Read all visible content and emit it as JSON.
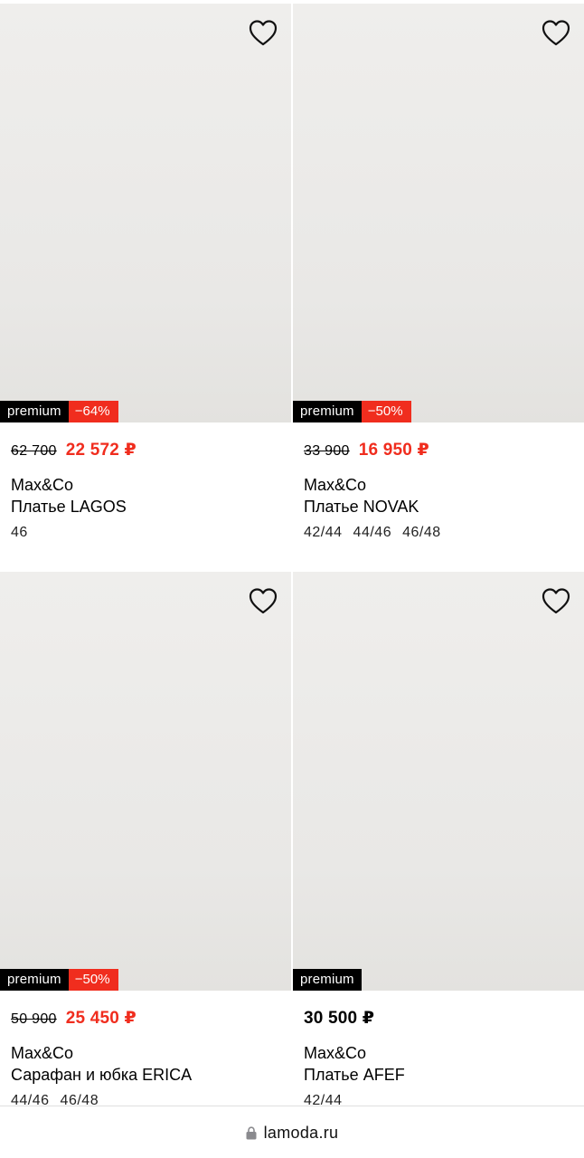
{
  "products": [
    {
      "badge_premium": "premium",
      "badge_discount": "−64%",
      "old_price": "62 700",
      "price": "22 572 ₽",
      "brand": "Max&Co",
      "name": "Платье LAGOS",
      "sizes": [
        "46"
      ],
      "dress_color": "#ebe3cf"
    },
    {
      "badge_premium": "premium",
      "badge_discount": "−50%",
      "old_price": "33 900",
      "price": "16 950 ₽",
      "brand": "Max&Co",
      "name": "Платье NOVAK",
      "sizes": [
        "42/44",
        "44/46",
        "46/48"
      ],
      "dress_color": "#161616"
    },
    {
      "badge_premium": "premium",
      "badge_discount": "−50%",
      "old_price": "50 900",
      "price": "25 450 ₽",
      "brand": "Max&Co",
      "name": "Сарафан и юбка ERICA",
      "sizes": [
        "44/46",
        "46/48"
      ],
      "dress_color": "#3a1423"
    },
    {
      "badge_premium": "premium",
      "price": "30 500 ₽",
      "brand": "Max&Co",
      "name": "Платье AFEF",
      "sizes": [
        "42/44"
      ],
      "dress_color": "#141414"
    }
  ],
  "footer": {
    "url": "lamoda.ru",
    "lock_icon": "lock-icon"
  },
  "colors": {
    "sale_red": "#f02d1e",
    "badge_black": "#000000"
  }
}
